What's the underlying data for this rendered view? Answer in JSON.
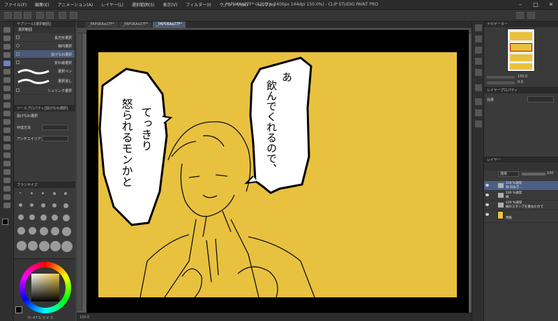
{
  "menu": {
    "items": [
      "ファイル(F)",
      "編集(E)",
      "アニメーション(A)",
      "レイヤー(L)",
      "選択範囲(S)",
      "表示(V)",
      "フィルター(I)",
      "ウィンドウ(W)",
      "ヘルプ(H)"
    ],
    "window_title": "_PAPUKAe27F* (1200 × 2400px 144dpi 150.0%) - CLIP STUDIO PAINT PRO"
  },
  "document_tabs": [
    "_PAPUKAe27F*",
    "_PAPUKAe27F*",
    "_PAPUKAe27F*"
  ],
  "subtool": {
    "header": "サブツール[選択範囲]",
    "tab": "選択範囲",
    "items": [
      {
        "label": "長方形選択",
        "selected": false
      },
      {
        "label": "楕円選択",
        "selected": false
      },
      {
        "label": "投げなわ選択",
        "selected": true
      },
      {
        "label": "折れ線選択",
        "selected": false
      },
      {
        "label": "選択ペン",
        "selected": false
      },
      {
        "label": "選択消し",
        "selected": false
      },
      {
        "label": "シュリンク選択",
        "selected": false
      }
    ]
  },
  "tool_property": {
    "header": "ツールプロパティ[投げなわ選択]",
    "title": "投げなわ選択",
    "labels": [
      "作成方法",
      "アンチエイリアス"
    ]
  },
  "brush_size": {
    "header": "ブラシサイズ"
  },
  "color": {
    "main": "#000000",
    "sub": "#ffffff",
    "values": "H: 47  S: 0  V: 0"
  },
  "canvas": {
    "background_color": "#e8c13f",
    "zoom": "150.0",
    "speech_bubbles": [
      {
        "text": "あ 飲んでくれるので、",
        "lines": [
          "あ",
          "飲んでくれるので、"
        ]
      },
      {
        "text": "てっきり 怒られるモンかと",
        "lines": [
          "てっきり",
          "怒られるモンかと"
        ]
      }
    ]
  },
  "navigator": {
    "header": "ナビゲーター",
    "zoom": "150.0",
    "rotation": "0.0"
  },
  "layer_property": {
    "header": "レイヤープロパティ",
    "effect_label": "効果"
  },
  "layers_panel": {
    "header": "レイヤー",
    "blend_mode": "通常",
    "opacity": "100",
    "layers": [
      {
        "name": "100 %通常\n顔 白ぬき…",
        "kind": "folder",
        "selected": true
      },
      {
        "name": "100 %通常\n線",
        "kind": "folder",
        "selected": false
      },
      {
        "name": "100 %通常\n線のスタンプを重ねたので",
        "kind": "folder",
        "selected": false
      },
      {
        "name": "用紙",
        "kind": "paper",
        "selected": false
      }
    ]
  },
  "status": {
    "zoom": "150.0"
  }
}
